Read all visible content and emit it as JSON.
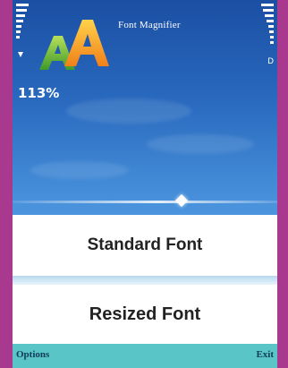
{
  "app": {
    "title": "Font Magnifier",
    "zoom_percent": "113%"
  },
  "status": {
    "battery_mark": "D"
  },
  "slider": {
    "value_fraction": 0.64
  },
  "preview": {
    "standard_label": "Standard Font",
    "resized_label": "Resized Font"
  },
  "softkeys": {
    "left_label": "Options",
    "right_label": "Exit"
  },
  "colors": {
    "frame": "#a9388f",
    "background_top": "#1b4fa3",
    "background_bottom": "#4c95de",
    "softkey_bar": "#59c5c7",
    "logo_green": "#7ac143",
    "logo_orange": "#f39a1e"
  },
  "icons": {
    "logo": "font-magnifier-logo",
    "signal": "signal-strength-icon",
    "battery": "battery-level-icon"
  }
}
